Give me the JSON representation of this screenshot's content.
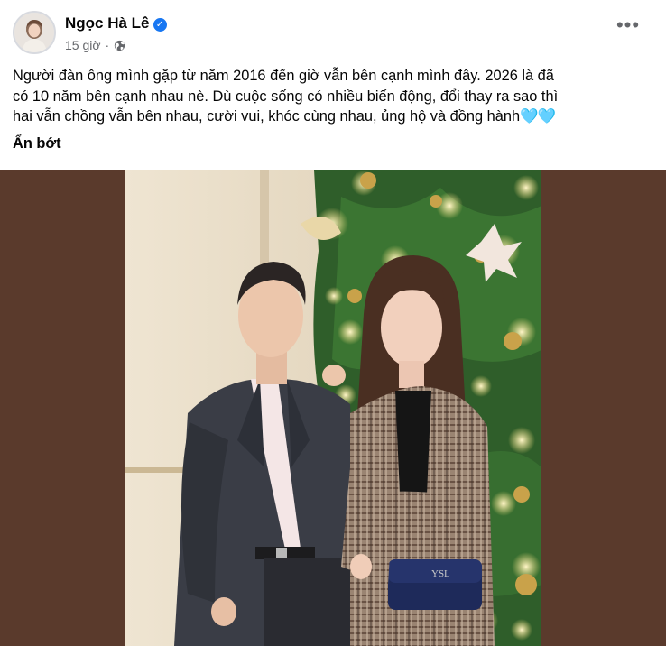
{
  "post": {
    "author": {
      "name": "Ngọc Hà Lê",
      "verified": true
    },
    "timestamp": "15 giờ",
    "separator": "·",
    "privacy_icon": "globe-icon",
    "more_icon": "more-options-icon",
    "more_label": "•••",
    "caption_lines": [
      "Người đàn ông mình gặp từ năm 2016 đến giờ vẫn bên cạnh mình đây. 2026 là đã",
      "có 10 năm bên cạnh nhau nè. Dù cuộc sống có nhiều biến động, đổi thay ra sao thì",
      "hai vẫn chồng vẫn bên nhau, cười vui, khóc cùng nhau, ủng hộ và đồng hành"
    ],
    "caption_emoji": "🩵🩵",
    "see_less": "Ẩn bớt"
  },
  "colors": {
    "background": "#ffffff",
    "text": "#050505",
    "meta": "#65676b",
    "verified": "#1877f2",
    "photo_bg": "#5a3a2c"
  }
}
